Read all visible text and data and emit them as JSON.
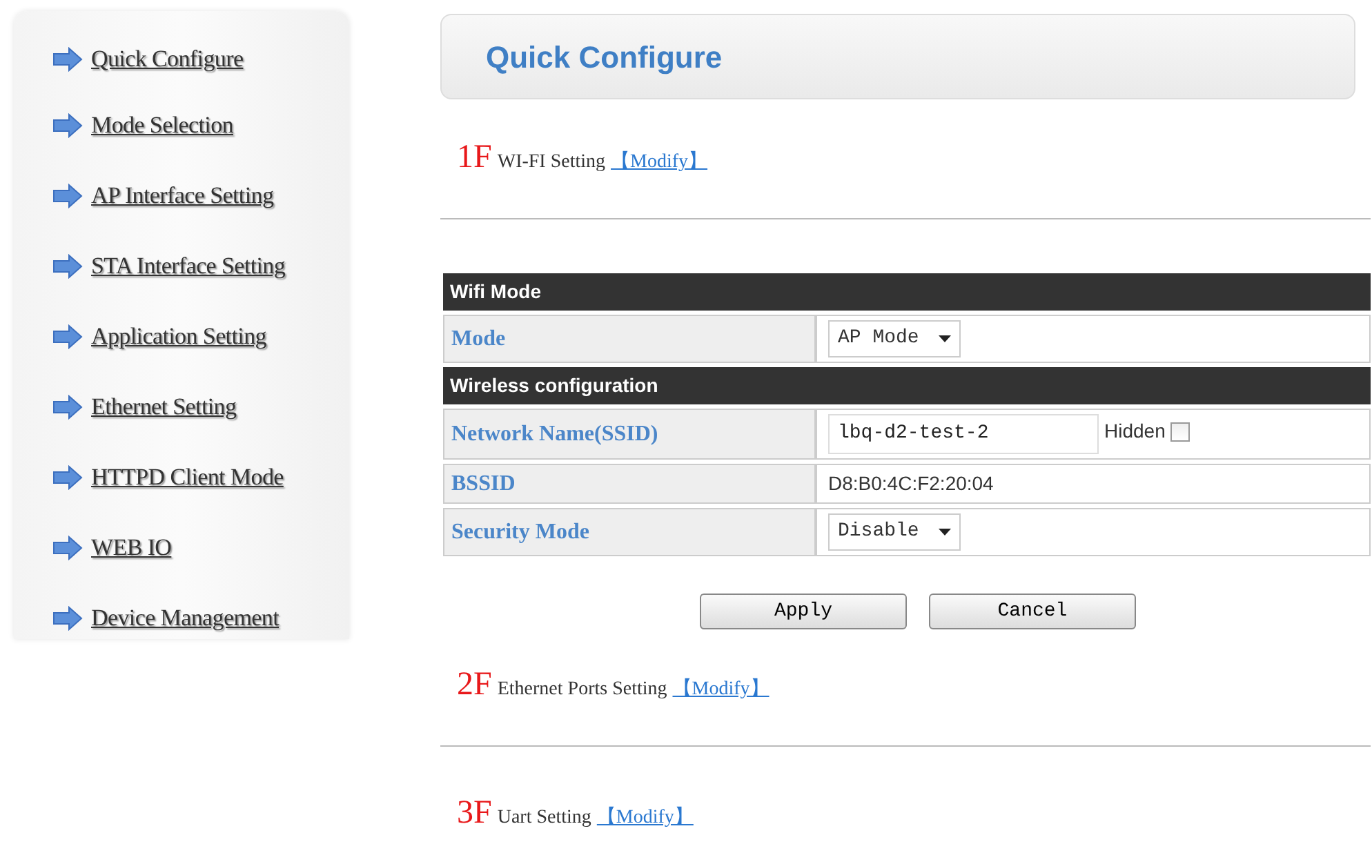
{
  "sidebar": {
    "items": [
      {
        "label": "Quick Configure"
      },
      {
        "label": "Mode Selection"
      },
      {
        "label": "AP Interface Setting"
      },
      {
        "label": "STA Interface Setting"
      },
      {
        "label": "Application Setting"
      },
      {
        "label": "Ethernet Setting"
      },
      {
        "label": "HTTPD Client Mode"
      },
      {
        "label": "WEB IO"
      },
      {
        "label": "Device Management"
      }
    ]
  },
  "page_title": "Quick Configure",
  "sections": [
    {
      "number": "1F",
      "title": "WI-FI Setting",
      "link": "【Modify】",
      "form": {
        "rows": [
          {
            "kind": "header",
            "label": "Wifi Mode"
          },
          {
            "kind": "select",
            "label": "Mode",
            "value": "AP Mode"
          },
          {
            "kind": "header",
            "label": "Wireless configuration"
          },
          {
            "kind": "text",
            "label": "Network Name(SSID)",
            "value": "lbq-d2-test-2",
            "checkbox": {
              "label": "Hidden",
              "checked": false
            }
          },
          {
            "kind": "static",
            "label": "BSSID",
            "value": "D8:B0:4C:F2:20:04"
          },
          {
            "kind": "select",
            "label": "Security Mode",
            "value": "Disable"
          }
        ],
        "buttons": [
          "Apply",
          "Cancel"
        ]
      }
    },
    {
      "number": "2F",
      "title": "Ethernet Ports Setting",
      "link": "【Modify】"
    },
    {
      "number": "3F",
      "title": "Uart Setting",
      "link": "【Modify】"
    }
  ]
}
